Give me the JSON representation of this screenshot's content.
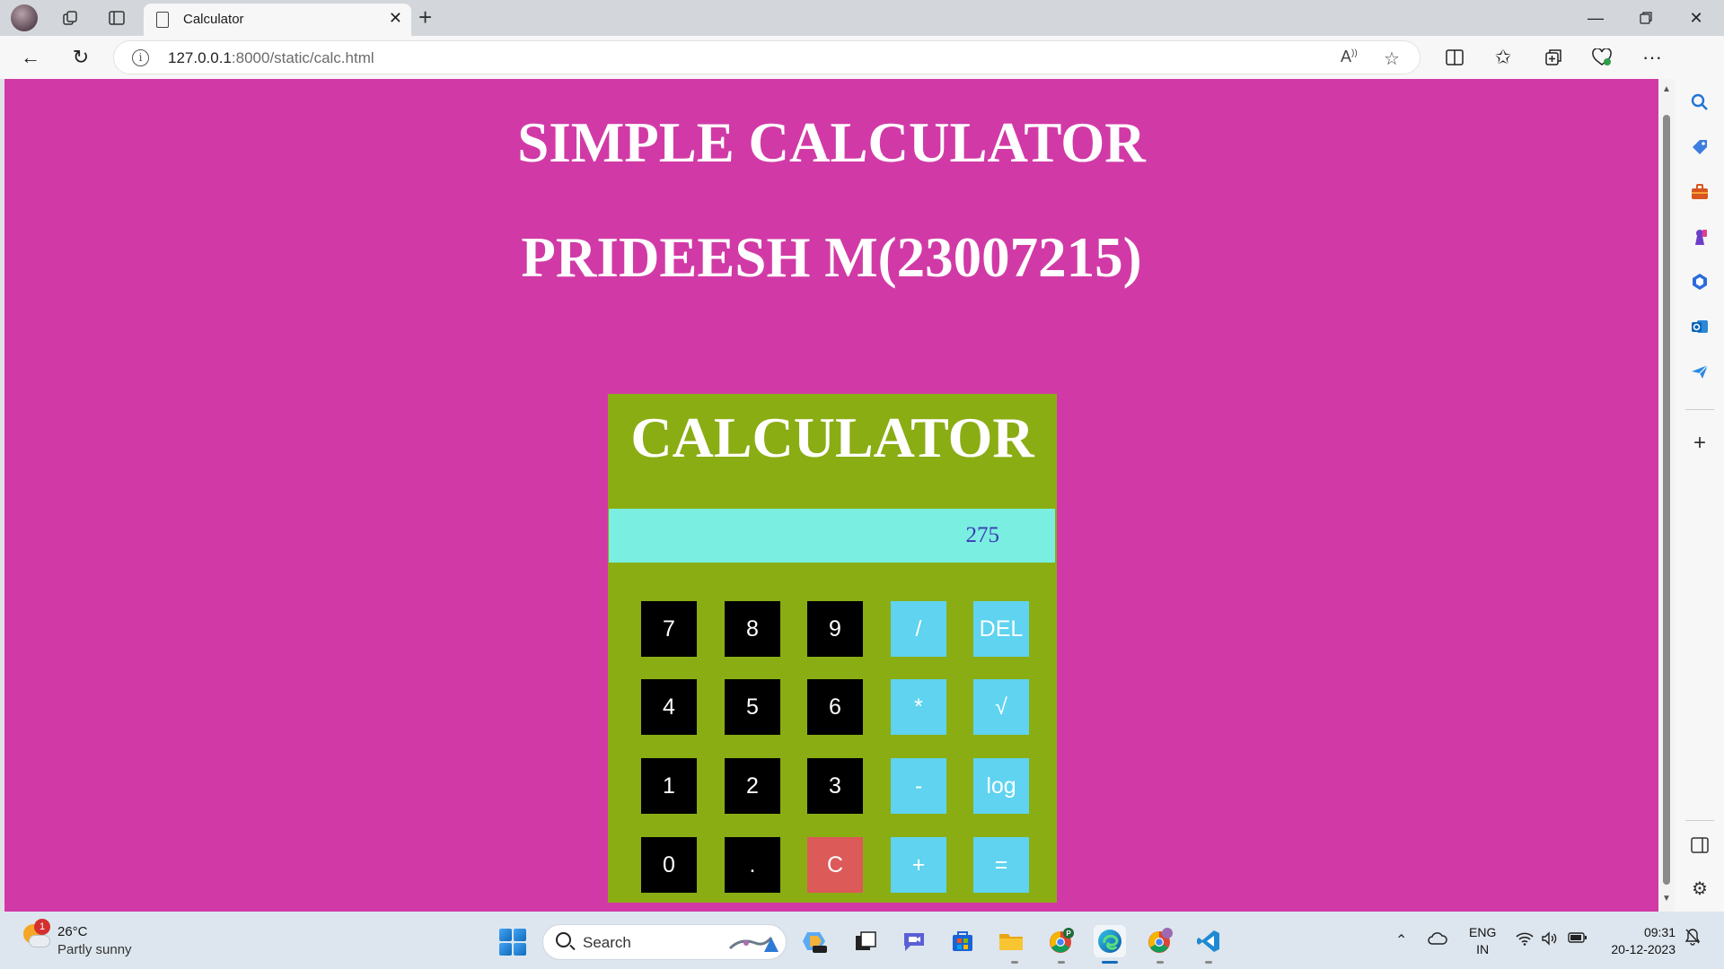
{
  "browser": {
    "tab": {
      "title": "Calculator"
    },
    "address": {
      "host": "127.0.0.1",
      "path": ":8000/static/calc.html"
    }
  },
  "page": {
    "heading": "SIMPLE CALCULATOR",
    "subheading": "PRIDEESH M(23007215)"
  },
  "calculator": {
    "title": "CALCULATOR",
    "display": "275",
    "keys": [
      [
        "7",
        "8",
        "9",
        "/",
        "DEL"
      ],
      [
        "4",
        "5",
        "6",
        "*",
        "√"
      ],
      [
        "1",
        "2",
        "3",
        "-",
        "log"
      ],
      [
        "0",
        ".",
        "C",
        "+",
        "="
      ]
    ],
    "colors": {
      "background": "#d13aa6",
      "panel": "#8aad14",
      "display": "#7aeee0",
      "number_key": "#000000",
      "operator_key": "#5fd3ef",
      "clear_key": "#dc5a58"
    }
  },
  "taskbar": {
    "weather": {
      "badge": "1",
      "temp": "26°C",
      "condition": "Partly sunny"
    },
    "search_label": "Search",
    "language": [
      "ENG",
      "IN"
    ],
    "time": "09:31",
    "date": "20-12-2023"
  }
}
